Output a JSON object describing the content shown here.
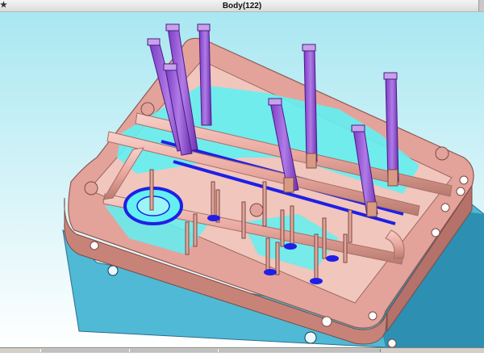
{
  "window": {
    "title": "Body(122)",
    "app_glyph": "★"
  },
  "viewport": {
    "background_top": "#a9e7f1",
    "background_bottom": "#ffffff",
    "colors": {
      "plate": "#e3a39a",
      "plate_edge": "#c88378",
      "base": "#4fb9d6",
      "base_dark": "#2d8fb1",
      "insert": "#62f0f2",
      "pin": "#9b5bd6",
      "pin_dark": "#6b2fb0",
      "pin_cap": "#c7a2ea",
      "blue": "#1f1fe6",
      "pipe": "#f0b0a8",
      "pipe_edge": "#a86f66"
    },
    "model_name": "mold-assembly"
  }
}
